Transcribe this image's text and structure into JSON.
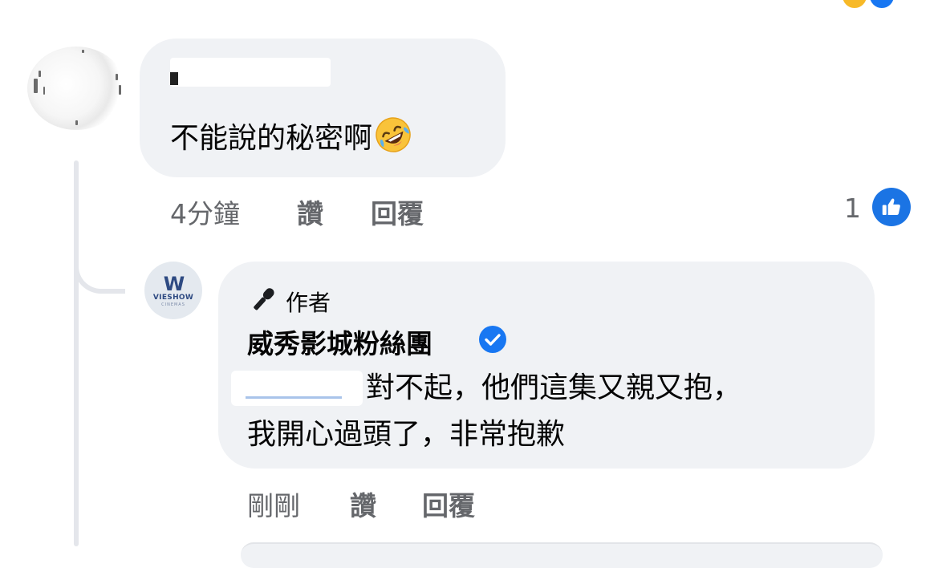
{
  "comment": {
    "text": "不能說的秘密啊",
    "emoji": "rolling-on-floor-laughing",
    "time": "4分鐘",
    "like_label": "讚",
    "reply_label": "回覆",
    "like_count": "1"
  },
  "reply": {
    "avatar_brand": "VIESHOW",
    "avatar_brand_sub": "CINEMAS",
    "author_badge": "作者",
    "page_name": "威秀影城粉絲團",
    "line1": "對不起，他們這集又親又抱，",
    "line2": "我開心過頭了，非常抱歉",
    "time": "剛剛",
    "like_label": "讚",
    "reply_label": "回覆"
  },
  "colors": {
    "bubble": "#f0f2f5",
    "meta_text": "#65676b",
    "like_blue": "#1b74e4",
    "brand_navy": "#2e4a82"
  }
}
